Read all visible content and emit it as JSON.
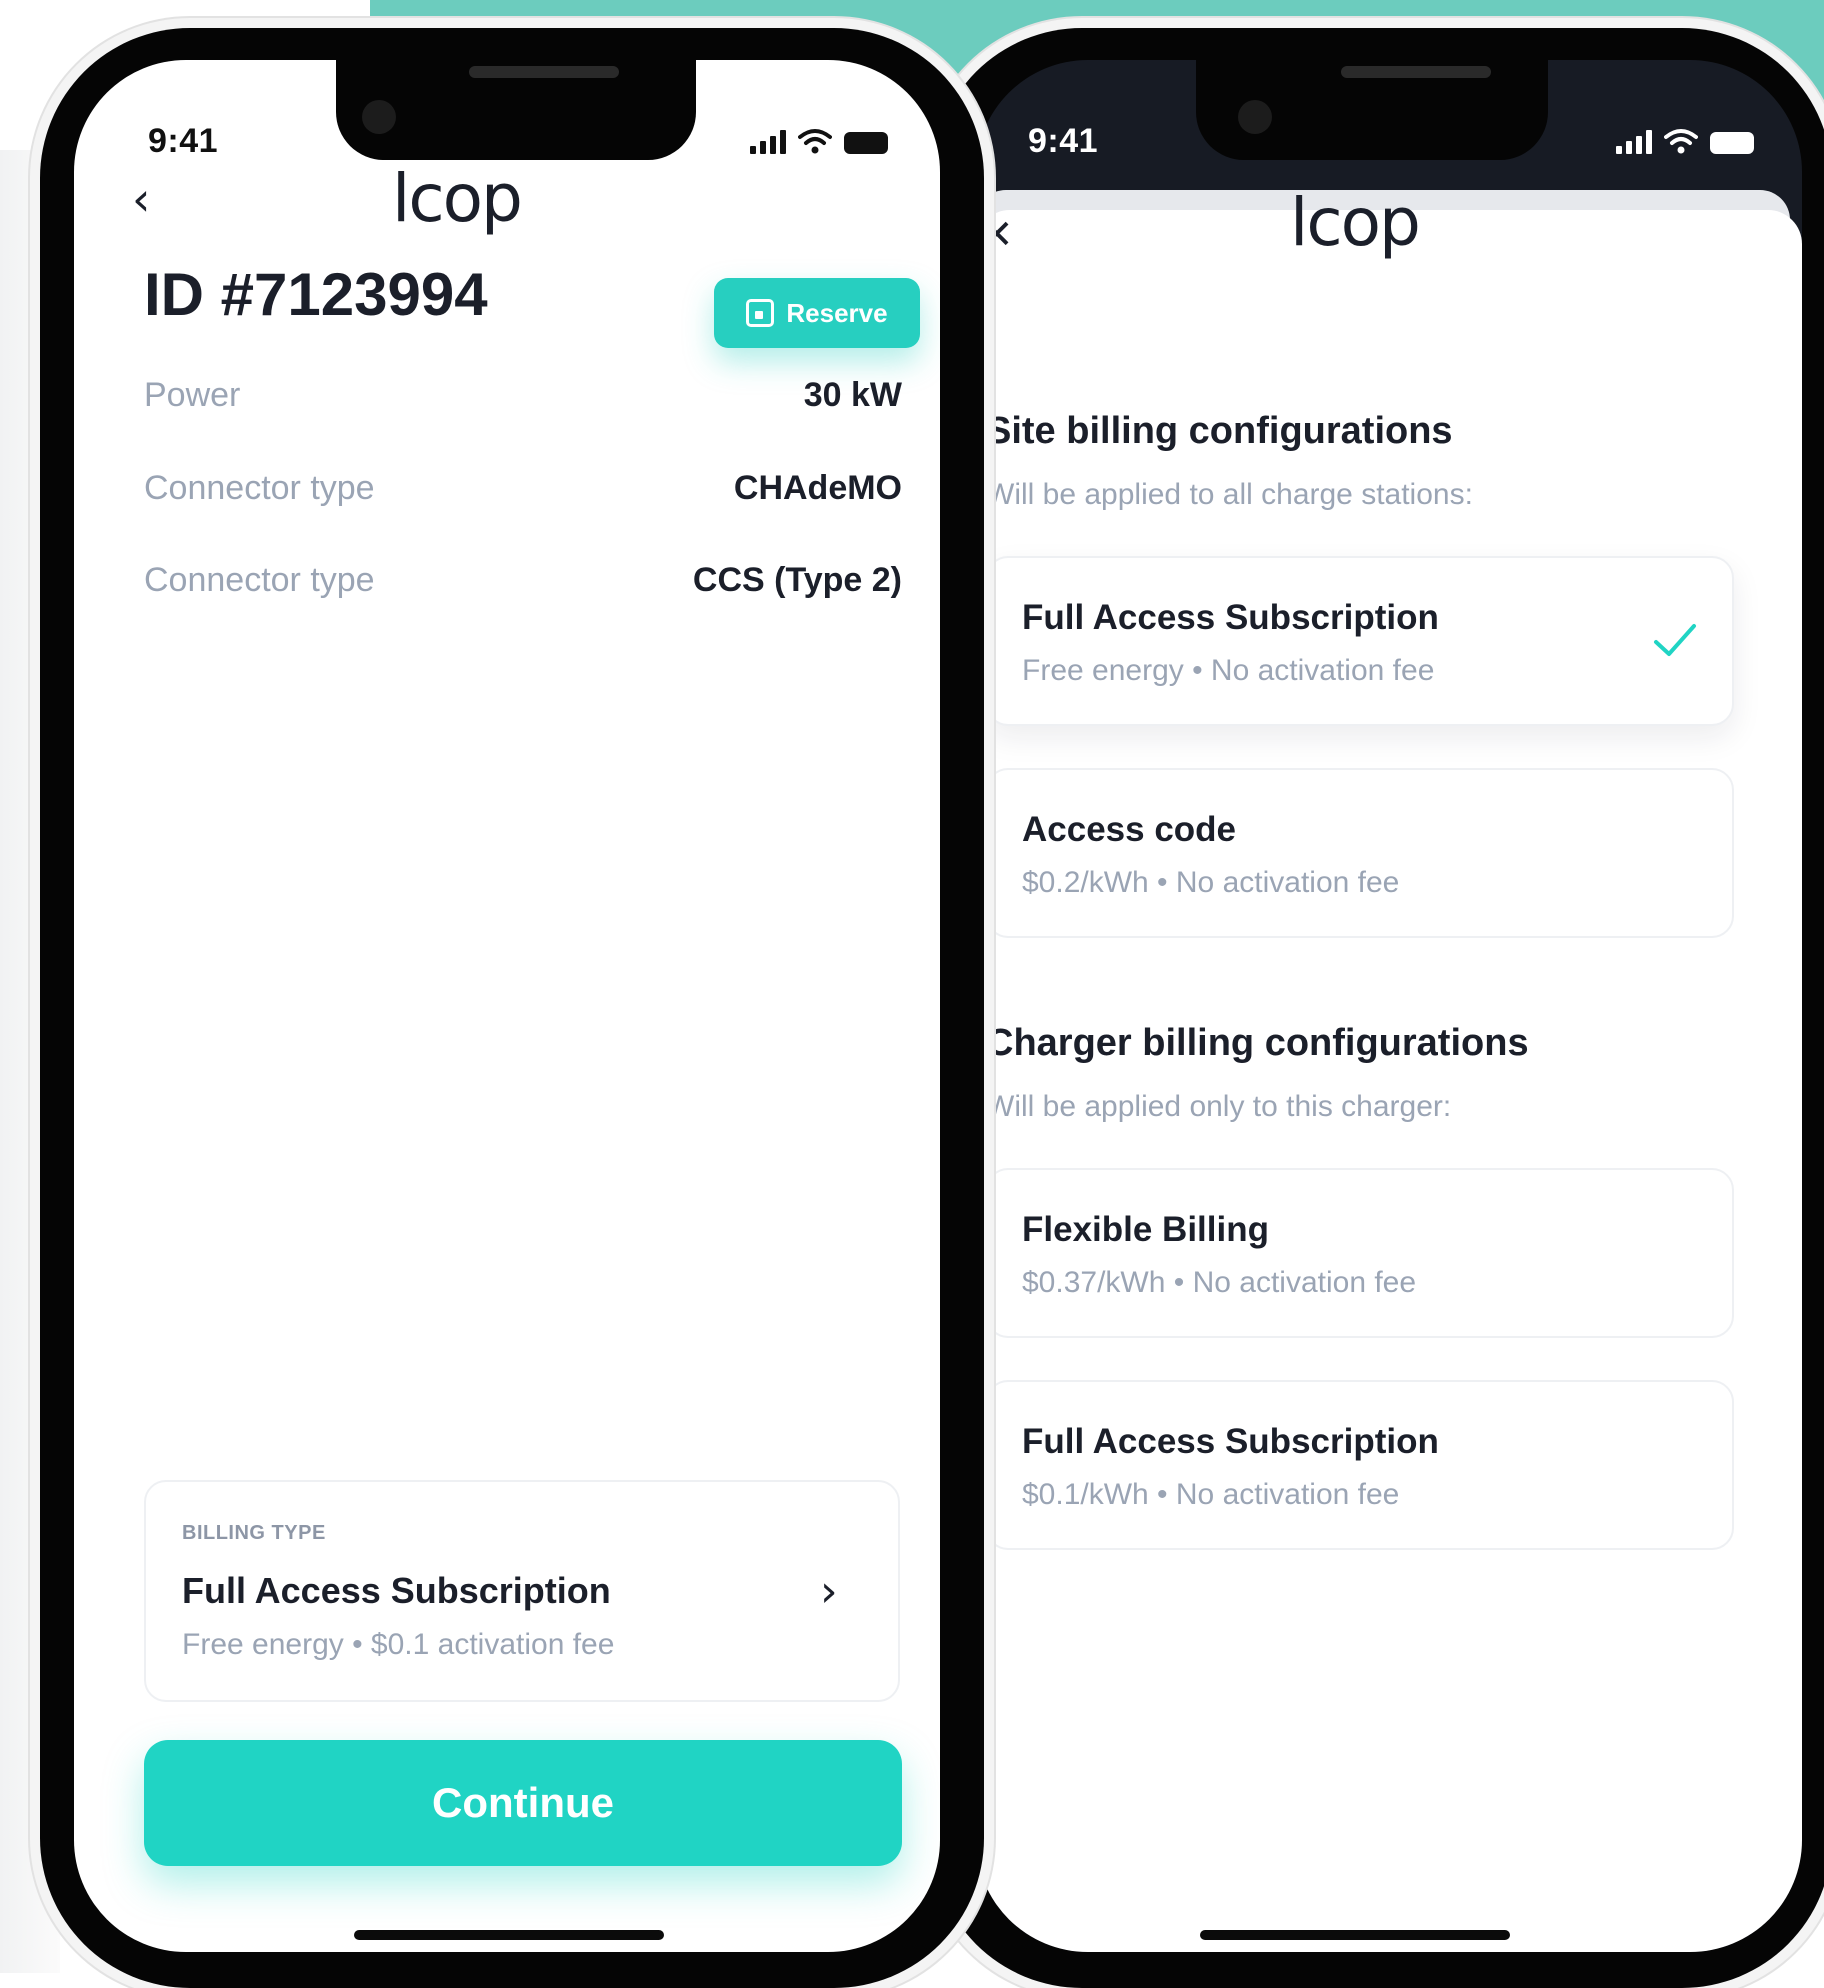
{
  "colors": {
    "accent": "#20d4c4",
    "accent_bg": "#6cccbe",
    "text_primary": "#1b1f2a",
    "text_secondary": "#9aa4b4"
  },
  "left_screen": {
    "status": {
      "time": "9:41"
    },
    "logo": "lcop",
    "back_icon": "chevron-left-icon",
    "charger_id": "ID #7123994",
    "reserve_button": {
      "label": "Reserve",
      "icon": "calendar-icon"
    },
    "specs": [
      {
        "label": "Power",
        "value": "30 kW"
      },
      {
        "label": "Connector type",
        "value": "CHAdeMO"
      },
      {
        "label": "Connector type",
        "value": "CCS (Type 2)"
      }
    ],
    "billing": {
      "caption": "BILLING TYPE",
      "title": "Full Access Subscription",
      "subtitle": "Free energy • $0.1 activation fee",
      "icon": "chevron-right-icon"
    },
    "continue_label": "Continue"
  },
  "right_screen": {
    "status": {
      "time": "9:41"
    },
    "logo": "lcop",
    "close_icon": "close-icon",
    "site_section": {
      "title": "Site billing configurations",
      "subtitle": "Will be applied to all charge stations:",
      "options": [
        {
          "title": "Full Access Subscription",
          "subtitle": "Free energy • No activation fee",
          "selected": true
        },
        {
          "title": "Access code",
          "subtitle": "$0.2/kWh • No activation fee",
          "selected": false
        }
      ]
    },
    "charger_section": {
      "title": "Charger billing configurations",
      "subtitle": "Will be applied only to this charger:",
      "options": [
        {
          "title": "Flexible Billing",
          "subtitle": "$0.37/kWh • No activation fee",
          "selected": false
        },
        {
          "title": "Full Access Subscription",
          "subtitle": "$0.1/kWh • No activation fee",
          "selected": false
        }
      ]
    }
  }
}
